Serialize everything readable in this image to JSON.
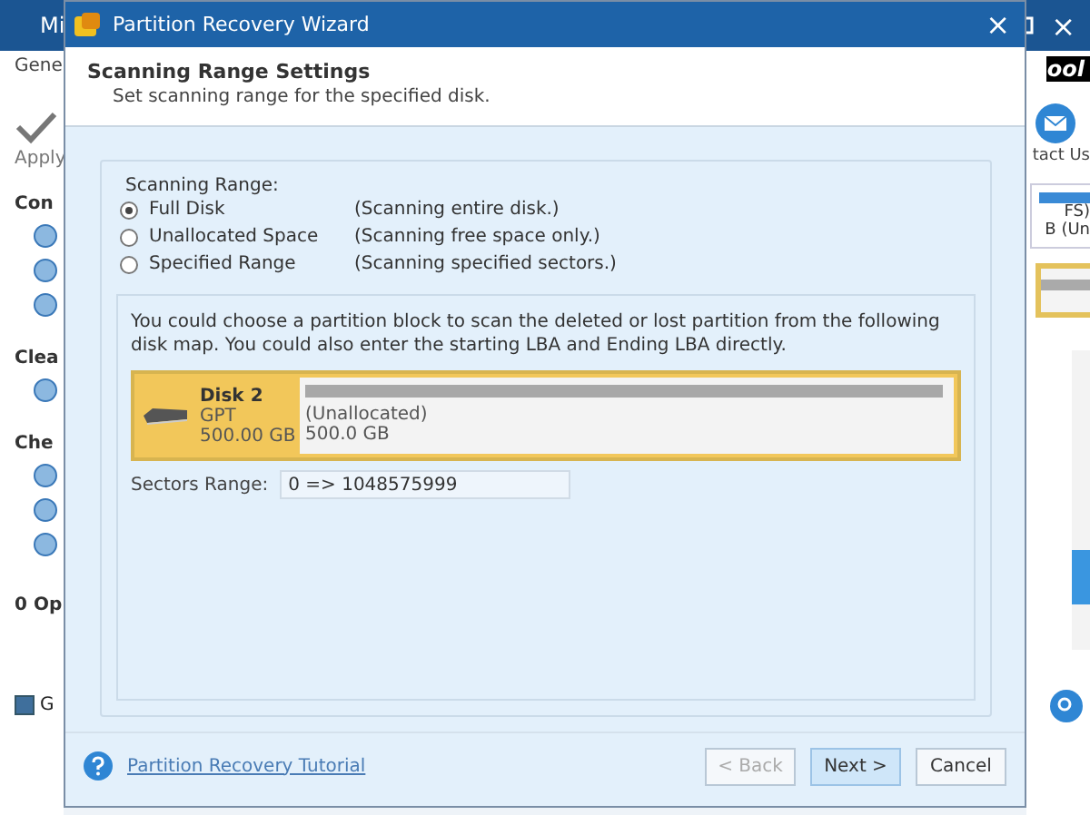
{
  "background_app": {
    "title": "Mi",
    "tab": "Gene",
    "apply_label": "Apply",
    "sections": [
      {
        "label": "Con"
      },
      {
        "label": "Clea"
      },
      {
        "label": "Che"
      }
    ],
    "operations": "0 Op",
    "checkbox": {
      "label": "G",
      "checked": true
    },
    "close": "×",
    "logo": "ool",
    "contact": "tact Us",
    "disk_lines": [
      "FS)",
      "B (Un"
    ]
  },
  "dialog": {
    "title": "Partition Recovery Wizard",
    "close": "×",
    "header_title": "Scanning Range Settings",
    "header_subtitle": "Set scanning range for the specified disk.",
    "group_label": "Scanning Range:",
    "options": [
      {
        "label": "Full Disk",
        "description": "(Scanning entire disk.)",
        "selected": true
      },
      {
        "label": "Unallocated Space",
        "description": "(Scanning free space only.)",
        "selected": false
      },
      {
        "label": "Specified Range",
        "description": "(Scanning specified sectors.)",
        "selected": false
      }
    ],
    "info": "You could choose a partition block to scan the deleted or lost partition from the following disk map. You could also enter the starting LBA and Ending LBA directly.",
    "disk": {
      "name": "Disk 2",
      "style": "GPT",
      "size": "500.00 GB",
      "selected": true,
      "partition_label": "(Unallocated)",
      "partition_size": "500.0 GB"
    },
    "sectors_label": "Sectors Range:",
    "sectors_value": "0 => 1048575999",
    "link": "Partition Recovery Tutorial",
    "buttons": [
      {
        "label": "< Back",
        "disabled": true,
        "primary": false
      },
      {
        "label": "Next >",
        "disabled": false,
        "primary": true
      },
      {
        "label": "Cancel",
        "disabled": false,
        "primary": false
      }
    ]
  }
}
